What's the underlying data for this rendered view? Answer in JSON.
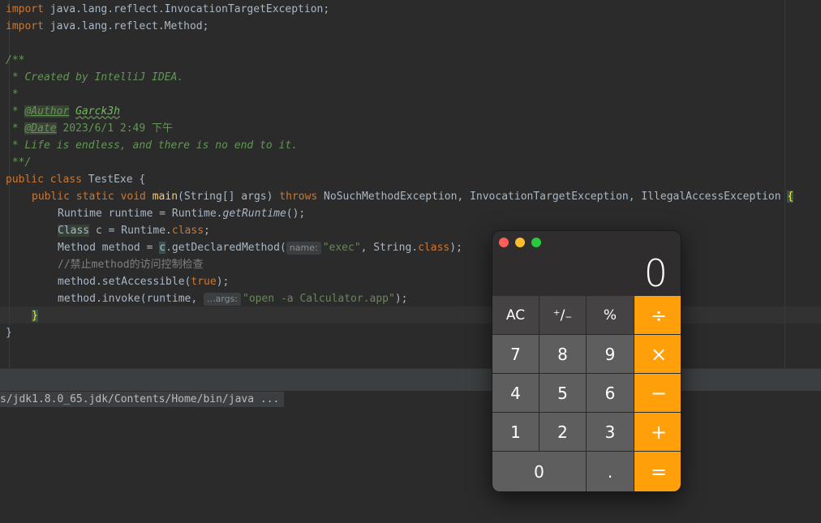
{
  "editor": {
    "lines": {
      "l1": {
        "kw": "import",
        "rest": " java.lang.reflect.InvocationTargetException;"
      },
      "l2": {
        "kw": "import",
        "rest": " java.lang.reflect.Method;"
      },
      "l4": "/**",
      "l5": " * Created by IntelliJ IDEA.",
      "l6": " *",
      "l7": {
        "pre": " * ",
        "tag": "@Author",
        "val": "Garck3h"
      },
      "l8": {
        "pre": " * ",
        "tag": "@Date",
        "val": " 2023/6/1 2:49 下午"
      },
      "l9": " * Life is endless, and there is no end to it.",
      "l10": " **/",
      "l11": {
        "kw1": "public",
        "kw2": "class",
        "name": " TestExe {"
      },
      "l12": {
        "kw": "public static void",
        "fn": "main",
        "params": "(String[] args) ",
        "throws": "throws",
        "exceptions": " NoSuchMethodException, InvocationTargetException, IllegalAccessException ",
        "brace": "{"
      },
      "l13": {
        "a": "Runtime runtime = Runtime.",
        "b": "getRuntime",
        "c": "();"
      },
      "l14": {
        "cls": "Class",
        "a": " c = Runtime.",
        "b": "class",
        "c": ";"
      },
      "l15": {
        "a": "Method method = ",
        "b": "c",
        "c": ".getDeclaredMethod(",
        "hint": "name:",
        "str": "\"exec\"",
        "d": ", String.",
        "e": "class",
        "f": ");"
      },
      "l16": "//禁止method的访问控制检查",
      "l17": {
        "a": "method.setAccessible(",
        "b": "true",
        "c": ");"
      },
      "l18": {
        "a": "method.invoke(runtime, ",
        "hint": "...args:",
        "str": "\"open -a Calculator.app\"",
        "c": ");"
      },
      "l19": "}",
      "l20": "}"
    }
  },
  "console": {
    "line": "s/jdk1.8.0_65.jdk/Contents/Home/bin/java ..."
  },
  "calculator": {
    "display": "0",
    "keys": {
      "ac": "AC",
      "plusminus": "⁺∕₋",
      "percent": "%",
      "divide": "÷",
      "seven": "7",
      "eight": "8",
      "nine": "9",
      "multiply": "×",
      "four": "4",
      "five": "5",
      "six": "6",
      "minus": "−",
      "one": "1",
      "two": "2",
      "three": "3",
      "plus": "+",
      "zero": "0",
      "decimal": ".",
      "equals": "="
    },
    "colors": {
      "operator": "#ff9f0a",
      "function": "#454343",
      "digit": "#5f5e5e"
    }
  }
}
